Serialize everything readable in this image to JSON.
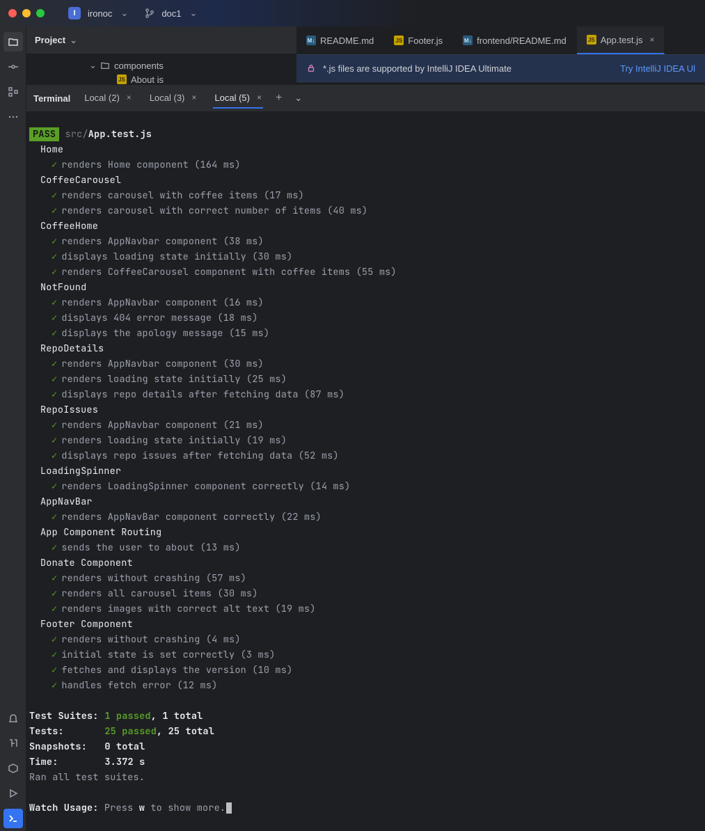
{
  "titlebar": {
    "project": "ironoc",
    "vcs": "doc1"
  },
  "project_panel": {
    "title": "Project",
    "tree": {
      "folder": "components",
      "file": "About is"
    }
  },
  "editor_tabs": [
    {
      "icon": "md",
      "label": "README.md",
      "active": false
    },
    {
      "icon": "js",
      "label": "Footer.js",
      "active": false
    },
    {
      "icon": "md",
      "label": "frontend/README.md",
      "active": false
    },
    {
      "icon": "js",
      "label": "App.test.js",
      "active": true
    }
  ],
  "notification": {
    "text": "*.js files are supported by IntelliJ IDEA Ultimate",
    "action": "Try IntelliJ IDEA Ul"
  },
  "terminal": {
    "title": "Terminal",
    "tabs": [
      {
        "label": "Local (2)",
        "active": false
      },
      {
        "label": "Local (3)",
        "active": false
      },
      {
        "label": "Local (5)",
        "active": true
      }
    ],
    "pass_badge": "PASS",
    "path_prefix": "src/",
    "path_file": "App.test.js",
    "suites": [
      {
        "name": "Home",
        "tests": [
          {
            "t": "renders Home component (164 ms)"
          }
        ]
      },
      {
        "name": "CoffeeCarousel",
        "tests": [
          {
            "t": "renders carousel with coffee items (17 ms)"
          },
          {
            "t": "renders carousel with correct number of items (40 ms)"
          }
        ]
      },
      {
        "name": "CoffeeHome",
        "tests": [
          {
            "t": "renders AppNavbar component (38 ms)"
          },
          {
            "t": "displays loading state initially (30 ms)"
          },
          {
            "t": "renders CoffeeCarousel component with coffee items (55 ms)"
          }
        ]
      },
      {
        "name": "NotFound",
        "tests": [
          {
            "t": "renders AppNavbar component (16 ms)"
          },
          {
            "t": "displays 404 error message (18 ms)"
          },
          {
            "t": "displays the apology message (15 ms)"
          }
        ]
      },
      {
        "name": "RepoDetails",
        "tests": [
          {
            "t": "renders AppNavbar component (30 ms)"
          },
          {
            "t": "renders loading state initially (25 ms)"
          },
          {
            "t": "displays repo details after fetching data (87 ms)"
          }
        ]
      },
      {
        "name": "RepoIssues",
        "tests": [
          {
            "t": "renders AppNavbar component (21 ms)"
          },
          {
            "t": "renders loading state initially (19 ms)"
          },
          {
            "t": "displays repo issues after fetching data (52 ms)"
          }
        ]
      },
      {
        "name": "LoadingSpinner",
        "tests": [
          {
            "t": "renders LoadingSpinner component correctly (14 ms)"
          }
        ]
      },
      {
        "name": "AppNavBar",
        "tests": [
          {
            "t": "renders AppNavBar component correctly (22 ms)"
          }
        ]
      },
      {
        "name": "App Component Routing",
        "tests": [
          {
            "t": "sends the user to about (13 ms)"
          }
        ]
      },
      {
        "name": "Donate Component",
        "tests": [
          {
            "t": "renders without crashing (57 ms)"
          },
          {
            "t": "renders all carousel items (30 ms)"
          },
          {
            "t": "renders images with correct alt text (19 ms)"
          }
        ]
      },
      {
        "name": "Footer Component",
        "tests": [
          {
            "t": "renders without crashing (4 ms)"
          },
          {
            "t": "initial state is set correctly (3 ms)"
          },
          {
            "t": "fetches and displays the version (10 ms)"
          },
          {
            "t": "handles fetch error (12 ms)"
          }
        ]
      }
    ],
    "summary": {
      "suites_label": "Test Suites:",
      "suites_passed": "1 passed",
      "suites_total": ", 1 total",
      "tests_label": "Tests:",
      "tests_passed": "25 passed",
      "tests_total": ", 25 total",
      "snapshots_label": "Snapshots:",
      "snapshots_value": "0 total",
      "time_label": "Time:",
      "time_value": "3.372 s",
      "ran": "Ran all test suites."
    },
    "watch": {
      "label": "Watch Usage:",
      "pre": " Press ",
      "key": "w",
      "post": " to show more."
    }
  },
  "icons": {
    "md": "M↓",
    "js": "JS"
  }
}
